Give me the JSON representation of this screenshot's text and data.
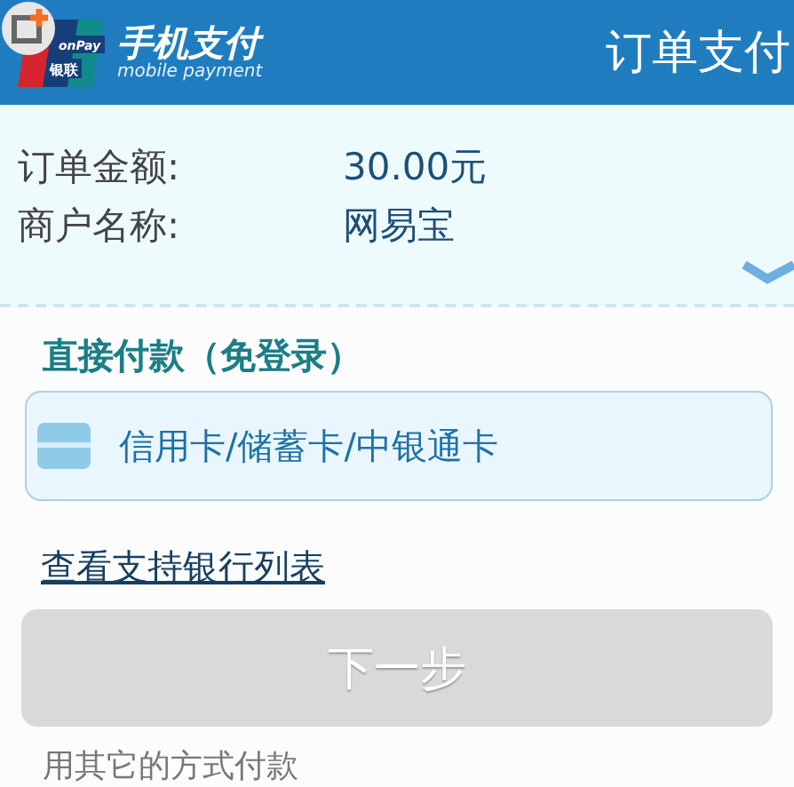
{
  "header": {
    "logo": {
      "brand": "onPay",
      "brand_cn": "银联",
      "title": "手机支付",
      "subtitle": "mobile payment"
    },
    "title": "订单支付"
  },
  "order": {
    "rows": [
      {
        "label": "订单金额:",
        "value": "30.00元"
      },
      {
        "label": "商户名称:",
        "value": "网易宝"
      }
    ],
    "expanded": false
  },
  "direct_pay": {
    "heading": "直接付款（免登录）",
    "card_option": "信用卡/储蓄卡/中银通卡",
    "bank_list_link": "查看支持银行列表",
    "next_button": {
      "label": "下一步",
      "disabled": true
    }
  },
  "other_methods": "用其它的方式付款"
}
